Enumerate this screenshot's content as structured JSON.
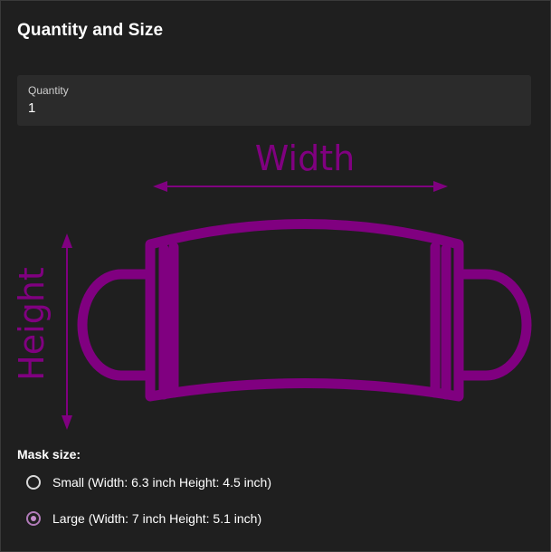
{
  "section": {
    "title": "Quantity and Size"
  },
  "quantity": {
    "label": "Quantity",
    "value": "1"
  },
  "diagram": {
    "width_label": "Width",
    "height_label": "Height",
    "color": "#800080"
  },
  "mask_size": {
    "heading": "Mask size:",
    "options": [
      {
        "label": "Small (Width: 6.3 inch Height: 4.5 inch)",
        "selected": false
      },
      {
        "label": "Large (Width: 7 inch Height: 5.1 inch)",
        "selected": true
      }
    ]
  },
  "colors": {
    "background": "#1f1f1f",
    "field_background": "#2b2b2b",
    "accent": "#800080",
    "radio_selected": "#c48acb"
  }
}
